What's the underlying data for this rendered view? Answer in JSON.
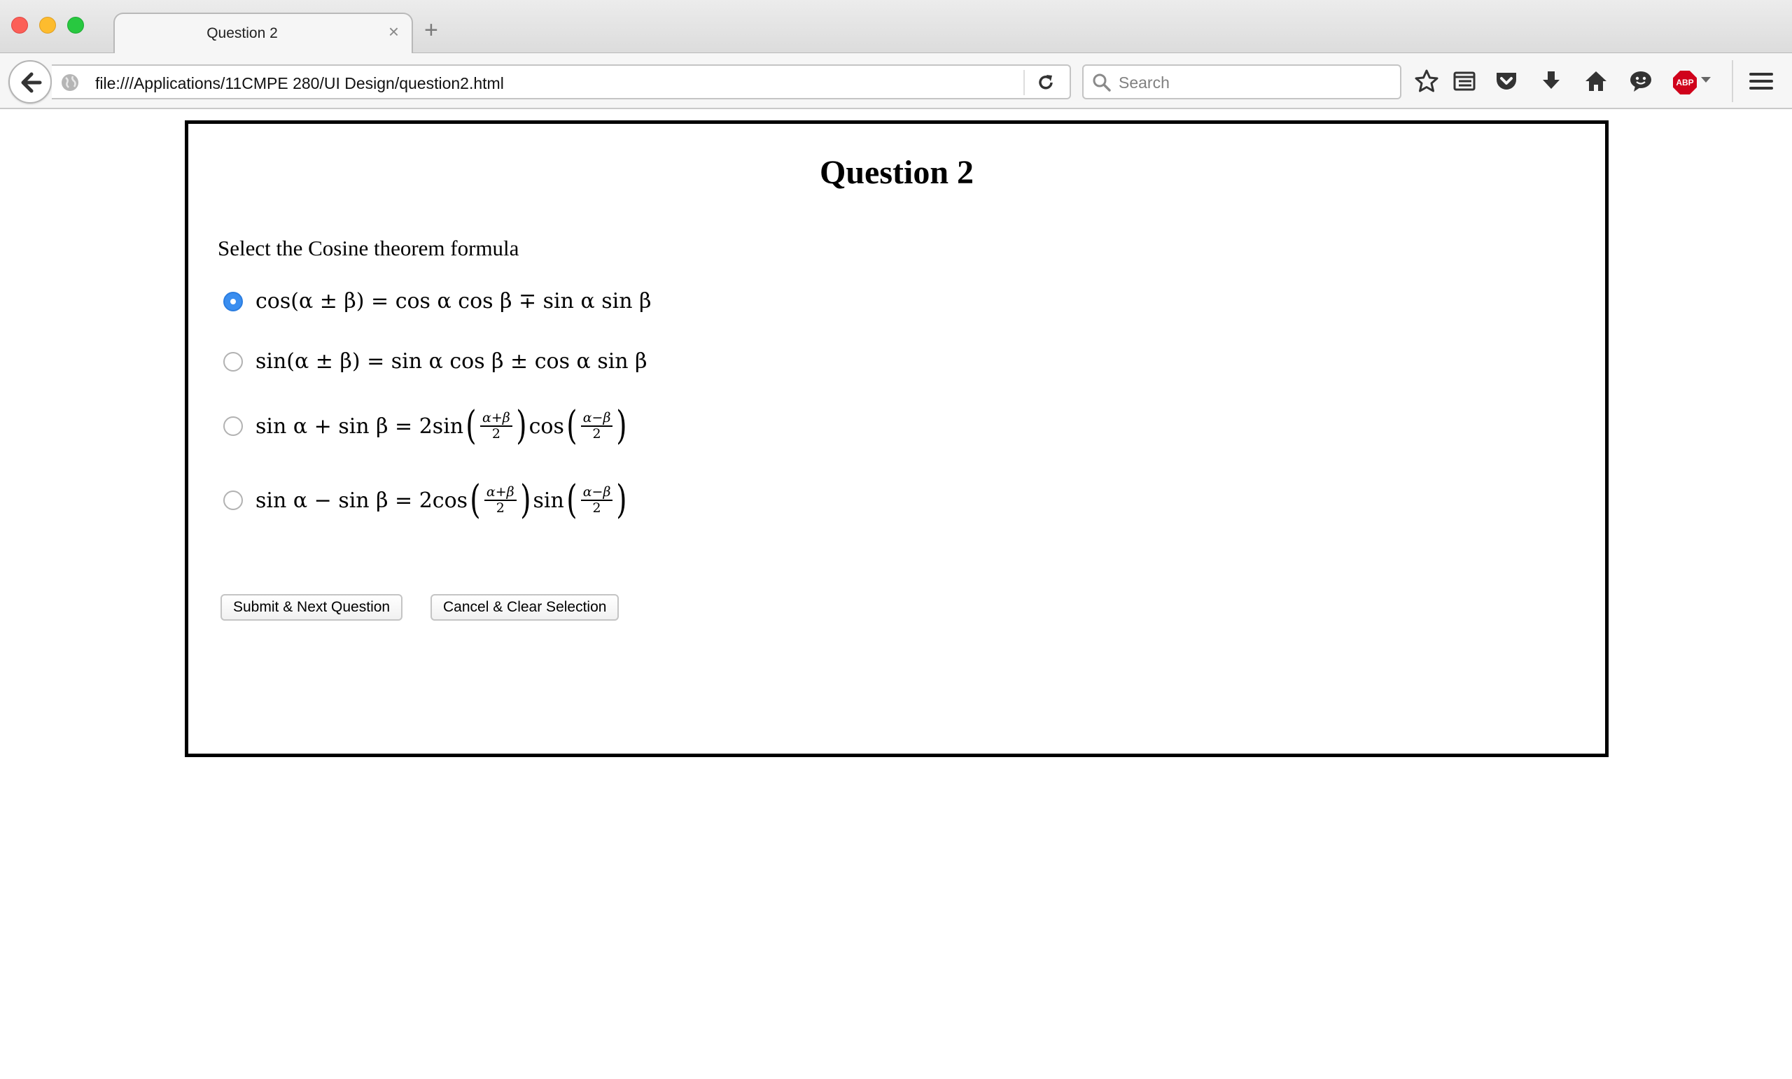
{
  "window": {
    "tab_title": "Question 2",
    "tab_close": "×",
    "new_tab": "+"
  },
  "toolbar": {
    "url": "file:///Applications/11CMPE 280/UI Design/question2.html",
    "search_placeholder": "Search",
    "abp_label": "ABP"
  },
  "page": {
    "title": "Question 2",
    "prompt": "Select the Cosine theorem formula",
    "options": [
      {
        "formula": "cos(α ± β) = cos α cos β ∓ sin α sin β",
        "checked": true
      },
      {
        "formula": "sin(α ± β) = sin α cos β ± cos α sin β",
        "checked": false
      },
      {
        "lhs": "sin α + sin β = 2sin",
        "f1_num": "α+β",
        "f1_den": "2",
        "mid": "cos",
        "f2_num": "α−β",
        "f2_den": "2",
        "checked": false
      },
      {
        "lhs": "sin α − sin β = 2cos",
        "f1_num": "α+β",
        "f1_den": "2",
        "mid": "sin",
        "f2_num": "α−β",
        "f2_den": "2",
        "checked": false
      }
    ],
    "buttons": {
      "submit": "Submit & Next Question",
      "cancel": "Cancel & Clear Selection"
    }
  },
  "colors": {
    "radio_selected": "#3a8ef0",
    "abp_red": "#d0021b",
    "box_border": "#000000"
  },
  "icons": [
    "back-arrow-icon",
    "globe-icon",
    "reload-icon",
    "search-icon",
    "bookmark-star-icon",
    "reading-list-icon",
    "pocket-icon",
    "download-icon",
    "home-icon",
    "chat-icon",
    "adblock-icon",
    "hamburger-menu-icon"
  ]
}
